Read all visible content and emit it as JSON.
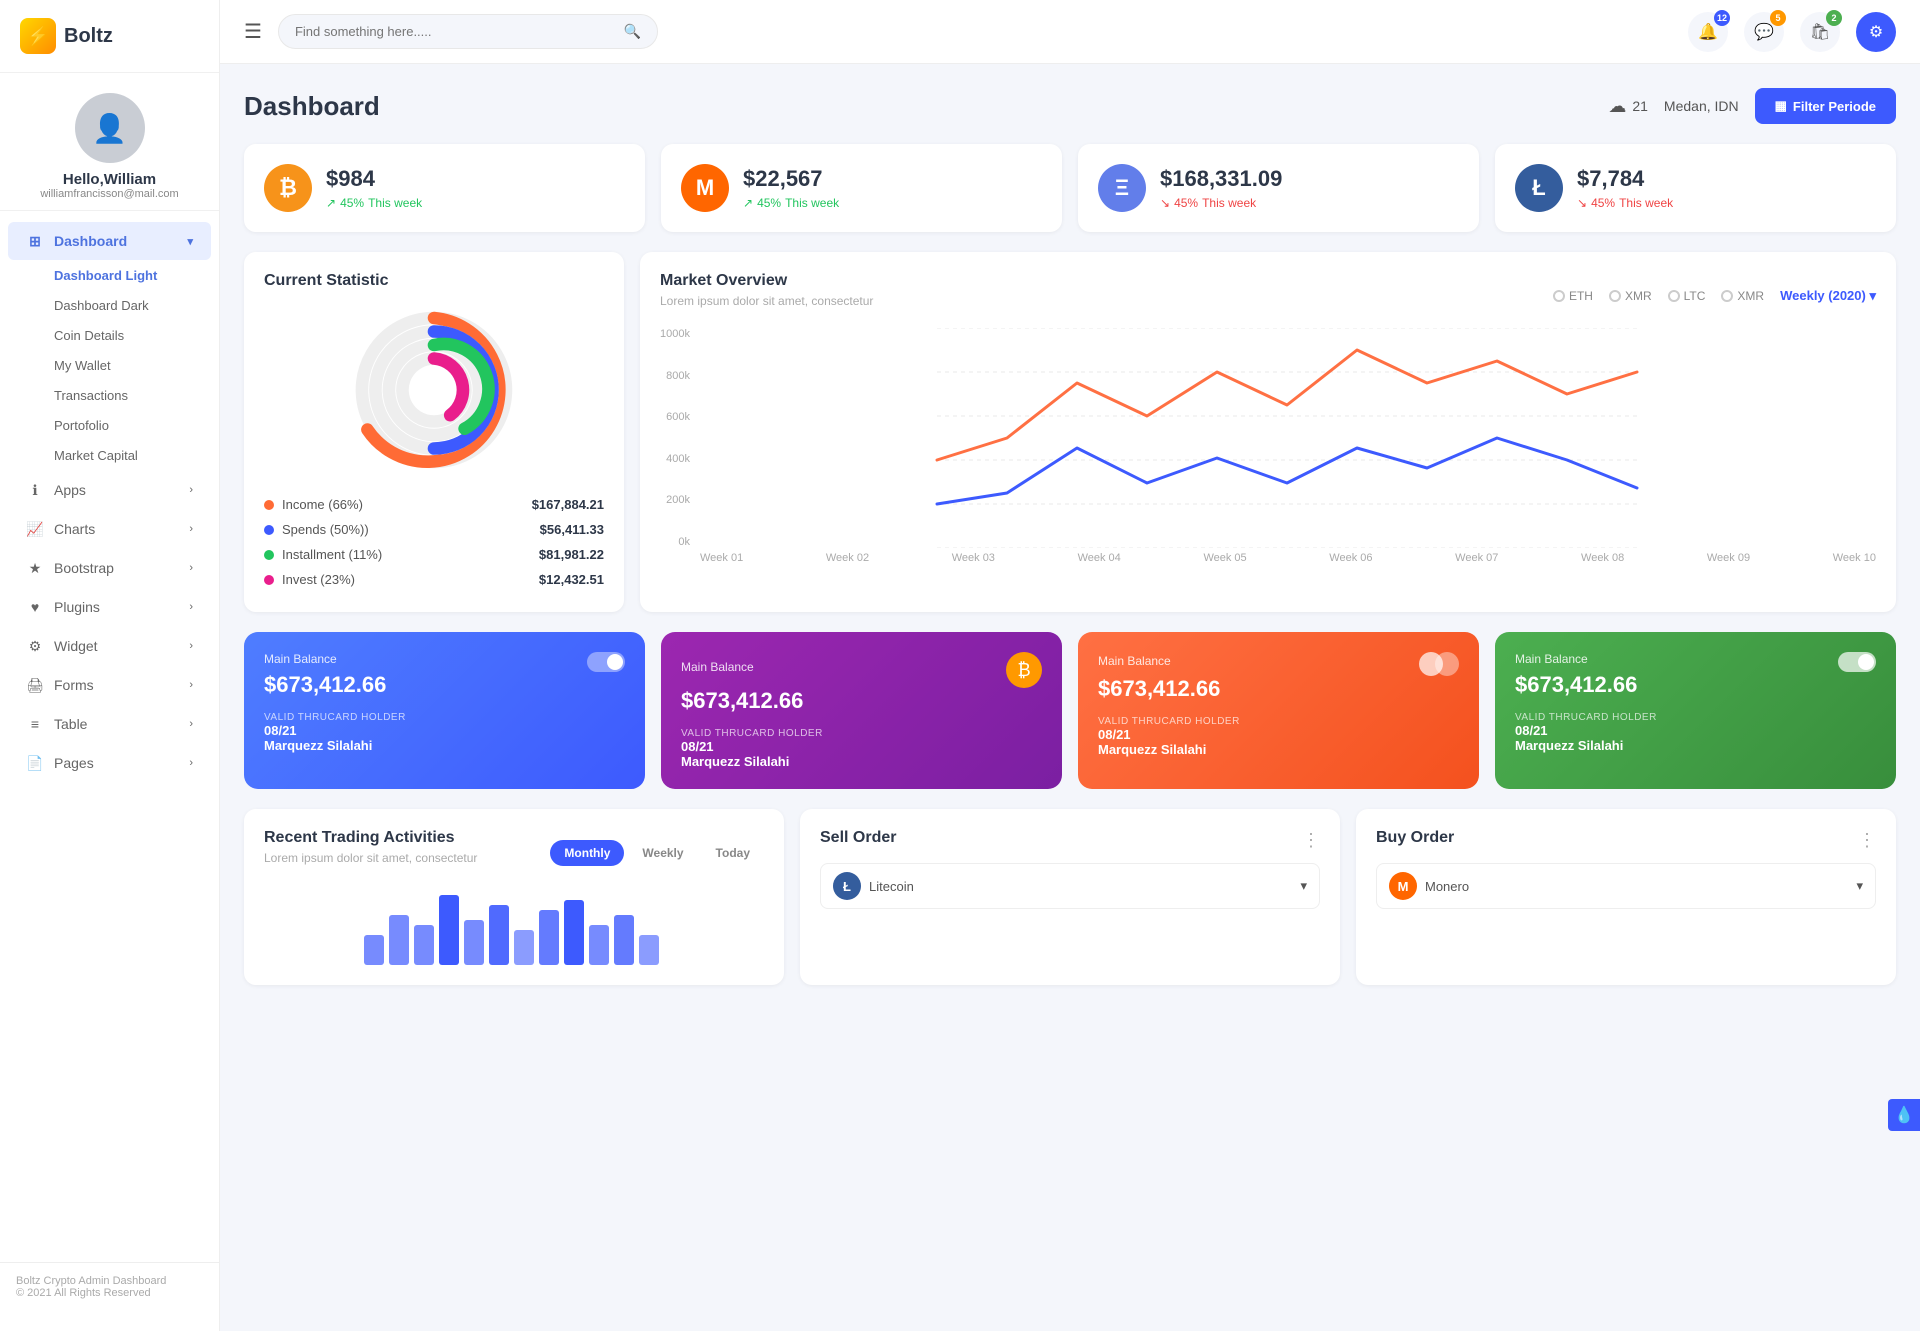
{
  "brand": {
    "name": "Boltz",
    "icon": "⚡"
  },
  "topbar": {
    "menu_icon": "☰",
    "search_placeholder": "Find something here.....",
    "notifications": {
      "count": 12,
      "badge_class": ""
    },
    "messages": {
      "count": 5,
      "badge_class": "orange"
    },
    "cart": {
      "count": 2,
      "badge_class": "green"
    }
  },
  "profile": {
    "greeting": "Hello,William",
    "email": "williamfrancisson@mail.com"
  },
  "sidebar": {
    "dashboard": {
      "label": "Dashboard",
      "items": [
        {
          "label": "Dashboard Light",
          "active": true
        },
        {
          "label": "Dashboard Dark",
          "active": false
        },
        {
          "label": "Coin Details",
          "active": false
        },
        {
          "label": "My Wallet",
          "active": false
        },
        {
          "label": "Transactions",
          "active": false
        },
        {
          "label": "Portofolio",
          "active": false
        },
        {
          "label": "Market Capital",
          "active": false
        }
      ]
    },
    "menu_items": [
      {
        "label": "Apps",
        "has_arrow": true
      },
      {
        "label": "Charts",
        "has_arrow": true
      },
      {
        "label": "Bootstrap",
        "has_arrow": true
      },
      {
        "label": "Plugins",
        "has_arrow": true
      },
      {
        "label": "Widget",
        "has_arrow": true
      },
      {
        "label": "Forms",
        "has_arrow": true
      },
      {
        "label": "Table",
        "has_arrow": true
      },
      {
        "label": "Pages",
        "has_arrow": true
      }
    ]
  },
  "page": {
    "title": "Dashboard",
    "weather": {
      "icon": "☁",
      "temp": "21"
    },
    "location": "Medan, IDN",
    "filter_btn": "Filter Periode"
  },
  "crypto_cards": [
    {
      "symbol": "BTC",
      "logo_class": "btc",
      "logo_text": "₿",
      "value": "$984",
      "change": "45%",
      "period": "This week",
      "direction": "up"
    },
    {
      "symbol": "MONO",
      "logo_class": "mono",
      "logo_text": "M",
      "value": "$22,567",
      "change": "45%",
      "period": "This week",
      "direction": "up"
    },
    {
      "symbol": "ETH",
      "logo_class": "eth",
      "logo_text": "Ξ",
      "value": "$168,331.09",
      "change": "45%",
      "period": "This week",
      "direction": "down"
    },
    {
      "symbol": "LTC",
      "logo_class": "ltc",
      "logo_text": "Ł",
      "value": "$7,784",
      "change": "45%",
      "period": "This week",
      "direction": "down"
    }
  ],
  "current_statistic": {
    "title": "Current Statistic",
    "legend": [
      {
        "label": "Income (66%)",
        "dot_class": "orange",
        "value": "$167,884.21"
      },
      {
        "label": "Spends (50%))",
        "dot_class": "blue",
        "value": "$56,411.33"
      },
      {
        "label": "Installment (11%)",
        "dot_class": "green",
        "value": "$81,981.22"
      },
      {
        "label": "Invest (23%)",
        "dot_class": "pink",
        "value": "$12,432.51"
      }
    ]
  },
  "market_overview": {
    "title": "Market Overview",
    "subtitle": "Lorem ipsum dolor sit amet, consectetur",
    "radio_labels": [
      "ETH",
      "XMR",
      "LTC",
      "XMR"
    ],
    "period_label": "Weekly (2020)",
    "y_labels": [
      "1000k",
      "800k",
      "600k",
      "400k",
      "200k",
      "0k"
    ],
    "x_labels": [
      "Week 01",
      "Week 02",
      "Week 03",
      "Week 04",
      "Week 05",
      "Week 06",
      "Week 07",
      "Week 08",
      "Week 09",
      "Week 10"
    ]
  },
  "balance_cards": [
    {
      "bg_class": "blue",
      "label": "Main Balance",
      "amount": "$673,412.66",
      "valid_label": "VALID THRUCARD HOLDER",
      "date": "08/21",
      "holder": "Marquezz Silalahi",
      "icon": "toggle"
    },
    {
      "bg_class": "purple",
      "label": "Main Balance",
      "amount": "$673,412.66",
      "valid_label": "VALID THRUCARD HOLDER",
      "date": "08/21",
      "holder": "Marquezz Silalahi",
      "icon": "₿"
    },
    {
      "bg_class": "orange",
      "label": "Main Balance",
      "amount": "$673,412.66",
      "valid_label": "VALID THRUCARD HOLDER",
      "date": "08/21",
      "holder": "Marquezz Silalahi",
      "icon": "mastercard"
    },
    {
      "bg_class": "green",
      "label": "Main Balance",
      "amount": "$673,412.66",
      "valid_label": "VALID THRUCARD HOLDER",
      "date": "08/21",
      "holder": "Marquezz Silalahi",
      "icon": "toggle"
    }
  ],
  "recent_trading": {
    "title": "Recent Trading Activities",
    "subtitle": "Lorem ipsum dolor sit amet, consectetur",
    "tabs": [
      "Monthly",
      "Weekly",
      "Today"
    ]
  },
  "sell_order": {
    "title": "Sell Order",
    "coin_label": "Litecoin"
  },
  "buy_order": {
    "title": "Buy Order",
    "coin_label": "Monero"
  },
  "footer": {
    "brand": "Boltz Crypto Admin Dashboard",
    "copy": "© 2021 All Rights Reserved"
  }
}
